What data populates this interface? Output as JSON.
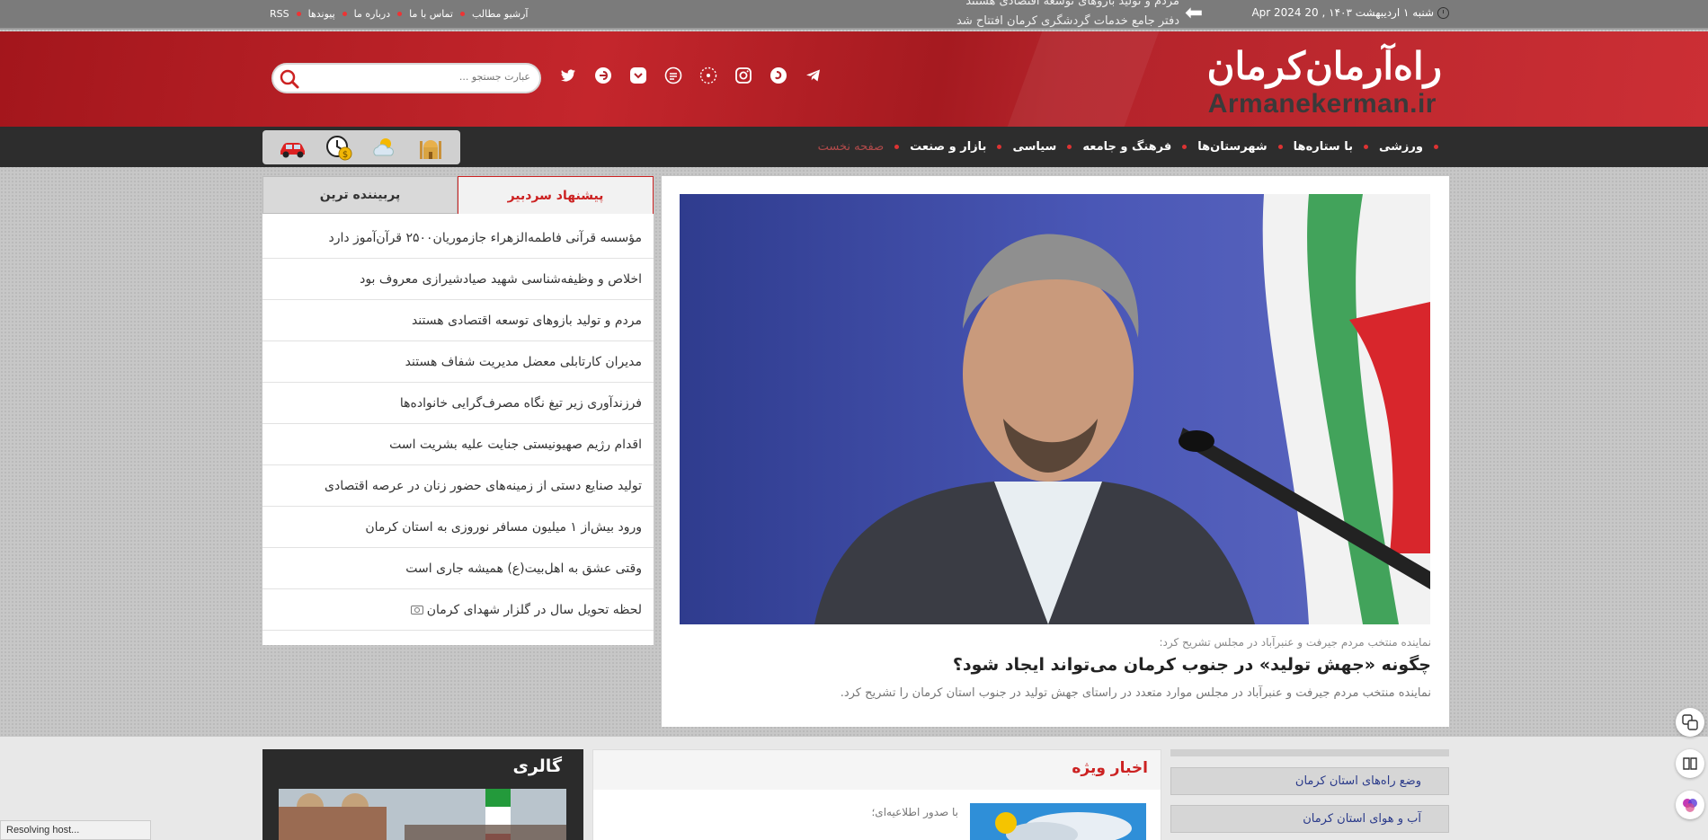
{
  "topbar": {
    "date": "شنبه ۱ اردیبهشت ۱۴۰۳ , 20 Apr 2024",
    "ticker_line1": "مردم و تولید بازوهای توسعه اقتصادی هستند",
    "ticker_line2": "دفتر جامع خدمات گردشگری کرمان افتتاح شد",
    "links": [
      "RSS",
      "پیوندها",
      "درباره ما",
      "تماس با ما",
      "آرشیو مطالب"
    ]
  },
  "header": {
    "logo_fa": "راه‌آرمان‌کرمان",
    "logo_en": "Armanekerman.ir",
    "search_placeholder": "عبارت جستجو ...",
    "social_icons": [
      "telegram-icon",
      "soroush-icon",
      "instagram-icon",
      "gap-icon",
      "igap-icon",
      "bale-icon",
      "virasty-icon",
      "eitaa-icon",
      "twitter-icon"
    ]
  },
  "nav": {
    "items": [
      "صفحه نخست",
      "بازار و صنعت",
      "سیاسی",
      "فرهنگ و جامعه",
      "شهرستان‌ها",
      "با ستاره‌ها",
      "ورزشی"
    ],
    "widgets": [
      "prayer-times-icon",
      "weather-icon",
      "currency-icon",
      "car-icon"
    ]
  },
  "tabs": {
    "active": "پیشنهاد سردبیر",
    "inactive": "پربیننده ترین",
    "items": [
      "مؤسسه قرآنی فاطمه‌الزهراء جازموریان۲۵۰۰ قرآن‌آموز دارد",
      "اخلاص و وظیفه‌شناسی شهید صیادشیرازی معروف بود",
      "مردم و تولید بازوهای توسعه اقتصادی هستند",
      "مدیران کارتابلی معضل مدیریت شفاف هستند",
      "فرزندآوری زیر تیغ نگاه مصرف‌گرایی خانواده‌ها",
      "اقدام رژیم صهیونیستی جنایت علیه بشریت است",
      "تولید صنایع دستی از زمینه‌های حضور زنان در عرصه اقتصادی",
      "ورود بیش‌از ۱ میلیون مسافر نوروزی به استان کرمان",
      "وقتی عشق به اهل‌بیت(ع) همیشه جاری است",
      "لحظه تحویل سال در گلزار شهدای کرمان"
    ]
  },
  "feature": {
    "lead": "نماینده منتخب مردم جیرفت و عنبرآباد در مجلس تشریح کرد:",
    "headline": "چگونه «جهش تولید» در جنوب کرمان می‌تواند ایجاد شود؟",
    "summary": "نماینده منتخب مردم جیرفت و عنبرآباد در مجلس موارد متعدد در راستای جهش تولید در جنوب استان کرمان را تشریح کرد."
  },
  "lower": {
    "gallery_title": "گالری",
    "special_title": "اخبار ویژه",
    "special_lead": "با صدور اطلاعیه‌ای؛",
    "links": [
      "وضع راه‌های استان کرمان",
      "آب و هوای استان کرمان"
    ]
  },
  "status": "Resolving host...",
  "colors": {
    "brand_red": "#c4262c",
    "nav_bg": "#2d2d2d",
    "accent_link": "#2a3a8a"
  }
}
